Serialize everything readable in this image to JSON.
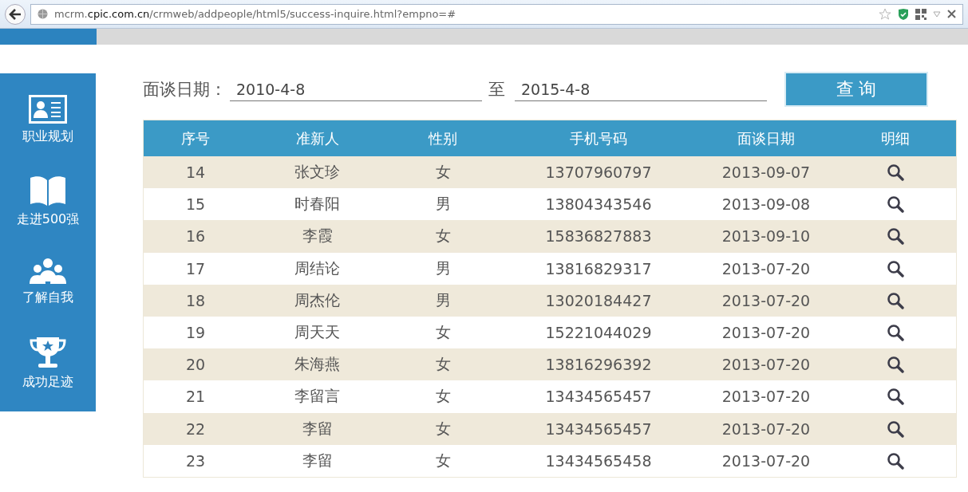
{
  "browser": {
    "url": "mcrm.**cpic.com.cn**/crmweb/addpeople/html5/success-inquire.html?empno=#"
  },
  "sidebar": {
    "items": [
      {
        "label": "职业规划",
        "kind": "card"
      },
      {
        "label": "走进500强",
        "kind": "book"
      },
      {
        "label": "了解自我",
        "kind": "people"
      },
      {
        "label": "成功足迹",
        "kind": "trophy"
      }
    ]
  },
  "search": {
    "label": "面谈日期：",
    "from": "2010-4-8",
    "separator": "至",
    "to": "2015-4-8",
    "button": "查 询"
  },
  "table": {
    "columns": [
      "序号",
      "准新人",
      "性别",
      "手机号码",
      "面谈日期",
      "明细"
    ],
    "rows": [
      [
        "14",
        "张文珍",
        "女",
        "13707960797",
        "2013-09-07"
      ],
      [
        "15",
        "时春阳",
        "男",
        "13804343546",
        "2013-09-08"
      ],
      [
        "16",
        "李霞",
        "女",
        "15836827883",
        "2013-09-10"
      ],
      [
        "17",
        "周结论",
        "男",
        "13816829317",
        "2013-07-20"
      ],
      [
        "18",
        "周杰伦",
        "男",
        "13020184427",
        "2013-07-20"
      ],
      [
        "19",
        "周天天",
        "女",
        "15221044029",
        "2013-07-20"
      ],
      [
        "20",
        "朱海燕",
        "女",
        "13816296392",
        "2013-07-20"
      ],
      [
        "21",
        "李留言",
        "女",
        "13434565457",
        "2013-07-20"
      ],
      [
        "22",
        "李留",
        "女",
        "13434565457",
        "2013-07-20"
      ],
      [
        "23",
        "李留",
        "女",
        "13434565458",
        "2013-07-20"
      ]
    ]
  }
}
